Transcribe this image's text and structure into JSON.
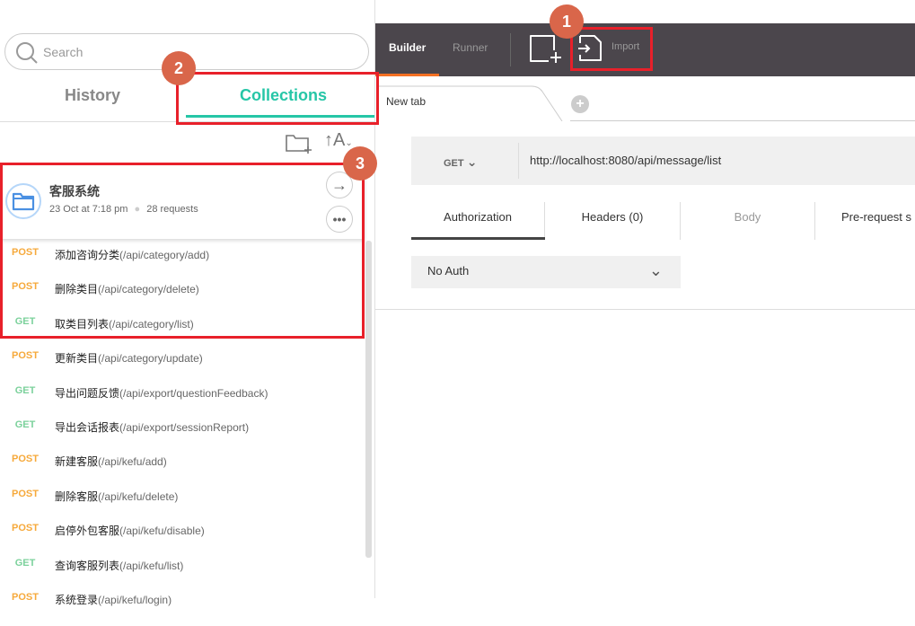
{
  "sidebar": {
    "search_placeholder": "Search",
    "tabs": {
      "history": "History",
      "collections": "Collections"
    },
    "collection": {
      "name": "客服系统",
      "date": "23 Oct at 7:18 pm",
      "requests": "28 requests"
    },
    "items": [
      {
        "method": "POST",
        "name": "添加咨询分类",
        "path": "(/api/category/add)"
      },
      {
        "method": "POST",
        "name": "删除类目",
        "path": "(/api/category/delete)"
      },
      {
        "method": "GET",
        "name": "取类目列表",
        "path": "(/api/category/list)"
      },
      {
        "method": "POST",
        "name": "更新类目",
        "path": "(/api/category/update)"
      },
      {
        "method": "GET",
        "name": "导出问题反馈",
        "path": "(/api/export/questionFeedback)"
      },
      {
        "method": "GET",
        "name": "导出会话报表",
        "path": "(/api/export/sessionReport)"
      },
      {
        "method": "POST",
        "name": "新建客服",
        "path": "(/api/kefu/add)"
      },
      {
        "method": "POST",
        "name": "删除客服",
        "path": "(/api/kefu/delete)"
      },
      {
        "method": "POST",
        "name": "启停外包客服",
        "path": "(/api/kefu/disable)"
      },
      {
        "method": "GET",
        "name": "查询客服列表",
        "path": "(/api/kefu/list)"
      },
      {
        "method": "POST",
        "name": "系统登录",
        "path": "(/api/kefu/login)"
      }
    ]
  },
  "header": {
    "builder": "Builder",
    "runner": "Runner",
    "import": "Import"
  },
  "tabs": {
    "new_tab": "New tab"
  },
  "request": {
    "method": "GET",
    "url": "http://localhost:8080/api/message/list"
  },
  "subtabs": [
    "Authorization",
    "Headers (0)",
    "Body",
    "Pre-request s"
  ],
  "auth": {
    "type": "No Auth"
  },
  "annotations": [
    "1",
    "2",
    "3"
  ],
  "colors": {
    "accent": "#26c6a7",
    "header": "#4b464c",
    "builder_underline": "#f47023",
    "post": "#f6a93b",
    "get": "#7bd19b",
    "annotation_box": "#e8202a",
    "annotation_badge": "#d9664a"
  }
}
